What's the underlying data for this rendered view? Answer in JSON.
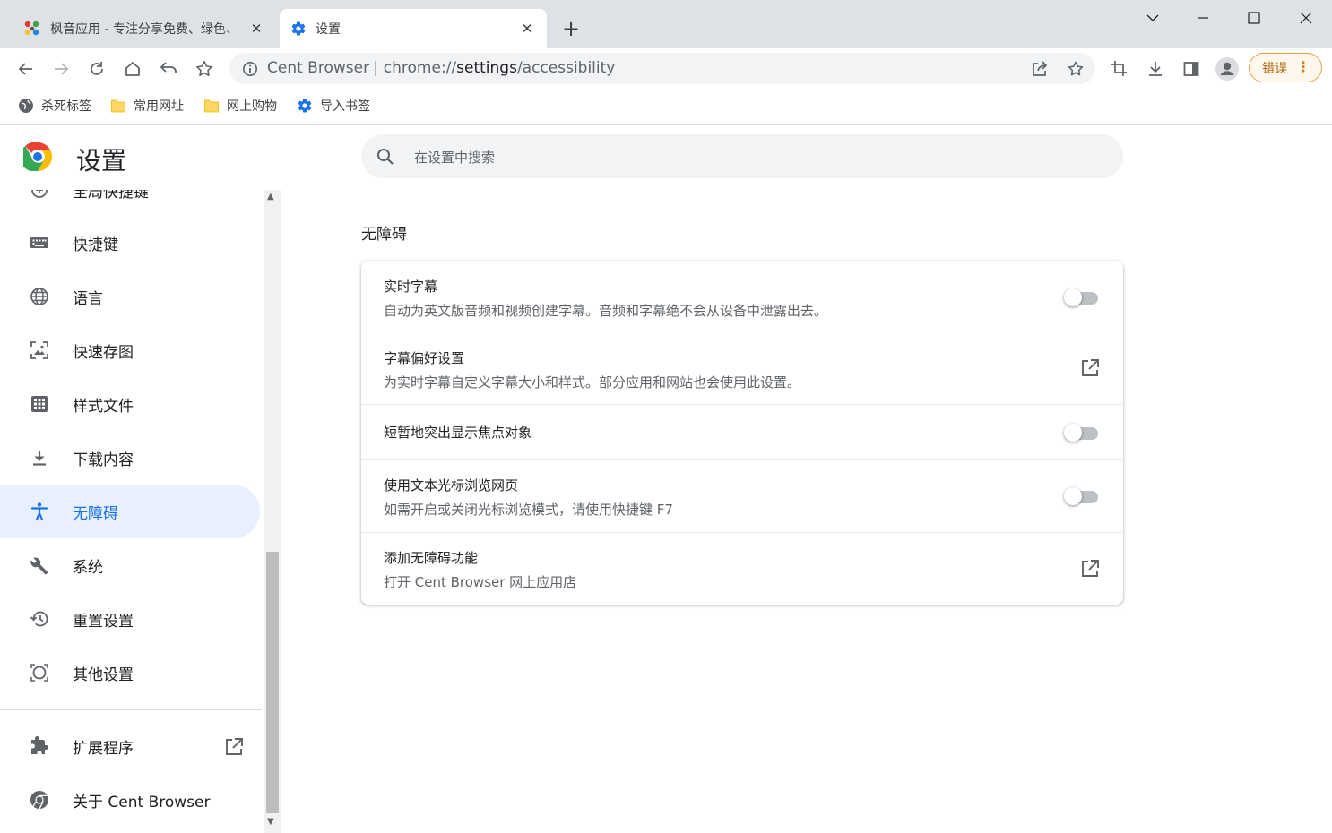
{
  "tabs": [
    {
      "title": "枫音应用 - 专注分享免费、绿色、",
      "close": "✕"
    },
    {
      "title": "设置",
      "close": "✕"
    }
  ],
  "toolbar": {
    "omnibox_brand": "Cent Browser",
    "omnibox_separator": "|",
    "url_prefix": "chrome://",
    "url_host": "settings",
    "url_path": "/accessibility",
    "error_label": "错误"
  },
  "bookmarks": [
    {
      "label": "杀死标签",
      "icon": "globe-icon"
    },
    {
      "label": "常用网址",
      "icon": "folder-icon"
    },
    {
      "label": "网上购物",
      "icon": "folder-icon"
    },
    {
      "label": "导入书签",
      "icon": "gear-icon"
    }
  ],
  "header": {
    "title": "设置",
    "search_placeholder": "在设置中搜索"
  },
  "sidebar": {
    "items": [
      {
        "label": "全局快捷键",
        "icon": "add-circle-icon"
      },
      {
        "label": "快捷键",
        "icon": "keyboard-icon"
      },
      {
        "label": "语言",
        "icon": "globe-icon"
      },
      {
        "label": "快速存图",
        "icon": "image-save-icon"
      },
      {
        "label": "样式文件",
        "icon": "grid-icon"
      },
      {
        "label": "下载内容",
        "icon": "download-icon"
      },
      {
        "label": "无障碍",
        "icon": "accessibility-icon",
        "active": true
      },
      {
        "label": "系统",
        "icon": "wrench-icon"
      },
      {
        "label": "重置设置",
        "icon": "history-icon"
      },
      {
        "label": "其他设置",
        "icon": "circle-frame-icon"
      }
    ],
    "extensions_label": "扩展程序",
    "about_label": "关于 Cent Browser"
  },
  "main": {
    "section_title": "无障碍",
    "rows": [
      {
        "label": "实时字幕",
        "sub": "自动为英文版音频和视频创建字幕。音频和字幕绝不会从设备中泄露出去。",
        "control": "toggle",
        "on": false
      },
      {
        "label": "字幕偏好设置",
        "sub": "为实时字幕自定义字幕大小和样式。部分应用和网站也会使用此设置。",
        "control": "external-link"
      },
      {
        "label": "短暂地突出显示焦点对象",
        "sub": "",
        "control": "toggle",
        "on": false
      },
      {
        "label": "使用文本光标浏览网页",
        "sub": "如需开启或关闭光标浏览模式，请使用快捷键 F7",
        "control": "toggle",
        "on": false
      },
      {
        "label": "添加无障碍功能",
        "sub": "打开 Cent Browser 网上应用店",
        "control": "external-link"
      }
    ]
  },
  "colors": {
    "accent": "#1a73e8",
    "active_bg": "#e8f0fe",
    "error_border": "#e8a04a"
  }
}
